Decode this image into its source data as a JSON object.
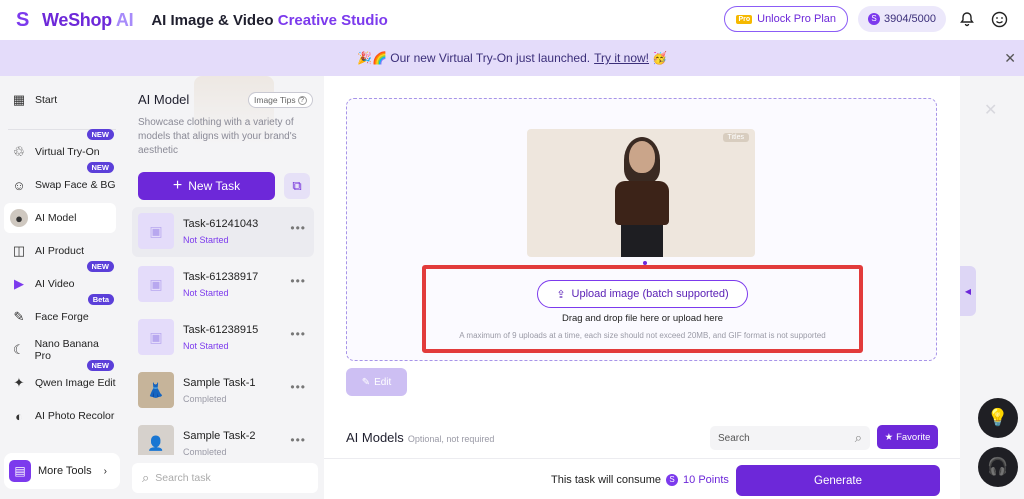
{
  "header": {
    "logo_mark": "S",
    "logo_text_main": "WeShop",
    "logo_text_ai": " AI",
    "studio_title_a": "AI Image & Video ",
    "studio_title_b": "Creative Studio",
    "pro_badge": "Pro",
    "unlock_label": "Unlock Pro Plan",
    "points_icon": "S",
    "points": "3904/5000",
    "bell_icon": "bell-icon",
    "avatar_icon": "smiley-icon"
  },
  "banner": {
    "text": "🎉🌈 Our new Virtual Try-On just launched.",
    "link": "Try it now!",
    "emoji": "🥳"
  },
  "sidebar": {
    "items": [
      {
        "label": "Start",
        "icon": "▦"
      },
      {
        "label": "Virtual Try-On",
        "icon": "♲",
        "badge": "NEW"
      },
      {
        "label": "Swap Face & BG",
        "icon": "☺",
        "badge": "NEW"
      },
      {
        "label": "AI Model",
        "icon": "●",
        "active": true
      },
      {
        "label": "AI Product",
        "icon": "◫"
      },
      {
        "label": "AI Video",
        "icon": "▶",
        "badge": "NEW"
      },
      {
        "label": "Face Forge",
        "icon": "✎",
        "badge": "Beta"
      },
      {
        "label": "Nano Banana Pro",
        "icon": "☾"
      },
      {
        "label": "Qwen Image Edit",
        "icon": "✦",
        "badge": "NEW"
      },
      {
        "label": "AI Photo Recolor",
        "icon": "◐"
      }
    ],
    "more_tools": "More Tools",
    "more_tools_icon": "▤",
    "more_tools_arrow": "›"
  },
  "task_panel": {
    "title": "AI Model",
    "image_tips": "Image Tips",
    "image_tips_icon": "?",
    "description": "Showcase clothing with a variety of models that aligns with your brand's aesthetic",
    "new_task": "New Task",
    "new_task_icon": "+",
    "copy_icon": "⧉",
    "tasks": [
      {
        "name": "Task-61241043",
        "status": "Not Started",
        "thumb": "▣"
      },
      {
        "name": "Task-61238917",
        "status": "Not Started",
        "thumb": "▣"
      },
      {
        "name": "Task-61238915",
        "status": "Not Started",
        "thumb": "▣"
      },
      {
        "name": "Sample Task-1",
        "status": "Completed",
        "thumb": "👗"
      },
      {
        "name": "Sample Task-2",
        "status": "Completed",
        "thumb": "👤"
      }
    ],
    "more_icon": "•••",
    "search_icon": "⌕",
    "search_placeholder": "Search task"
  },
  "main": {
    "preview_tag": "Titles",
    "upload_icon": "⇪",
    "upload_label": "Upload image (batch supported)",
    "drag_text": "Drag and drop file here or upload here",
    "limit_text": "A maximum of 9 uploads at a time, each size should not exceed 20MB, and GIF format is not supported",
    "edit_icon": "✎",
    "edit_label": "Edit",
    "models_title": "AI Models",
    "models_sub": "Optional, not required",
    "search_placeholder": "Search",
    "search_icon": "⌕",
    "favorite_icon": "★",
    "favorite_label": "Favorite",
    "consume_text": "This task will consume",
    "coin_icon": "S",
    "points": "10 Points",
    "generate": "Generate"
  },
  "right_rail": {
    "close_icon": "✕",
    "tab_icon": "◀",
    "bulb_icon": "💡",
    "support_icon": "🎧"
  },
  "colors": {
    "accent": "#6d28d9",
    "highlight": "#e23b3b",
    "banner_bg": "#e4dcfa"
  }
}
